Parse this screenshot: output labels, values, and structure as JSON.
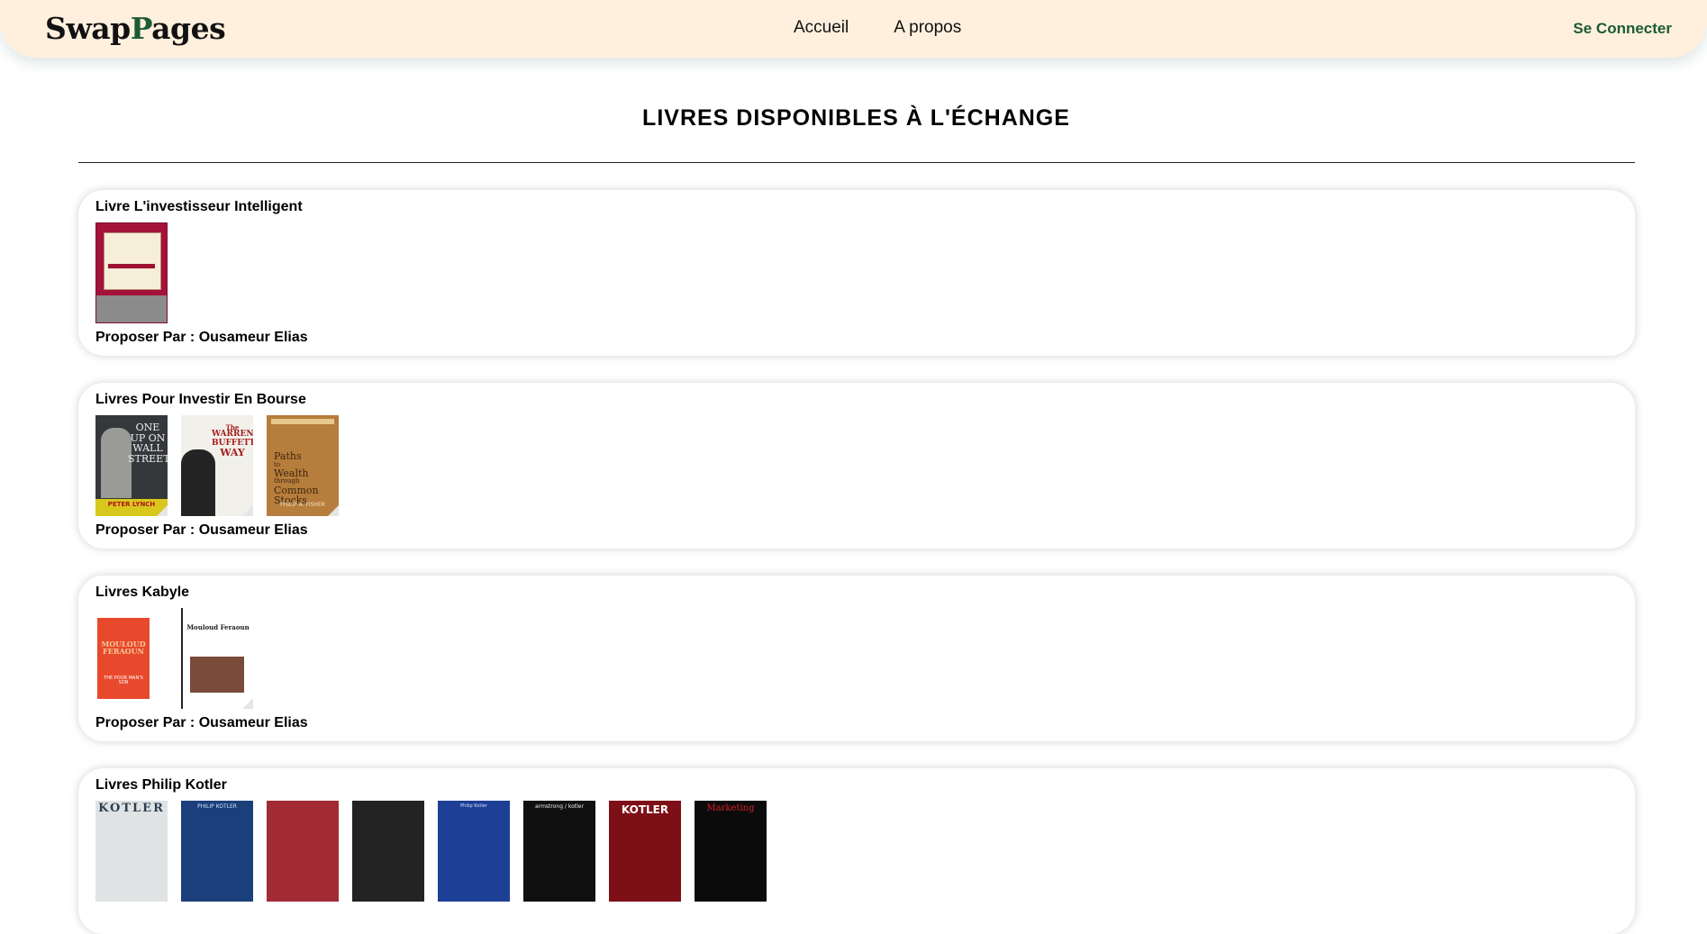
{
  "nav": {
    "logo_part1": "Swap",
    "logo_accent": "P",
    "logo_part2": "ages",
    "links": [
      "Accueil",
      "A propos"
    ],
    "login": "Se Connecter"
  },
  "main": {
    "title": "LIVRES DISPONIBLES À L'ÉCHANGE"
  },
  "listings": [
    {
      "title": "Livre L'investisseur Intelligent",
      "owner": "Proposer Par : Ousameur Elias"
    },
    {
      "title": "Livres Pour Investir En Bourse",
      "owner": "Proposer Par : Ousameur Elias"
    },
    {
      "title": "Livres Kabyle",
      "owner": "Proposer Par : Ousameur Elias"
    },
    {
      "title": "Livres Philip Kotler"
    }
  ],
  "covers": {
    "buffett_1": "The",
    "buffett_2": "WARREN",
    "buffett_3": "BUFFETT",
    "buffett_4": "WAY",
    "lynch_1": "ONE",
    "lynch_2": "UP ON",
    "lynch_3": "WALL",
    "lynch_4": "STREET",
    "lynch_author": "PETER LYNCH",
    "fisher_1": "Paths",
    "fisher_2": "to",
    "fisher_3": "Wealth",
    "fisher_4": "through",
    "fisher_5": "Common",
    "fisher_6": "Stocks",
    "fisher_author": "PHILIP A. FISHER",
    "feraoun_author_1": "MOULOUD",
    "feraoun_author_2": "FERAOUN",
    "feraoun_title": "THE POOR MAN'S SON",
    "feraoun2_title": "Mouloud Feraoun",
    "kotler_1": "KOTLER",
    "kotler_2": "PHILIP KOTLER",
    "kotler_3": "armstrong / kotler",
    "kotler_4": "KOTLER",
    "kotler_5": "Marketing",
    "kotler_6": "Philip Kotler"
  }
}
